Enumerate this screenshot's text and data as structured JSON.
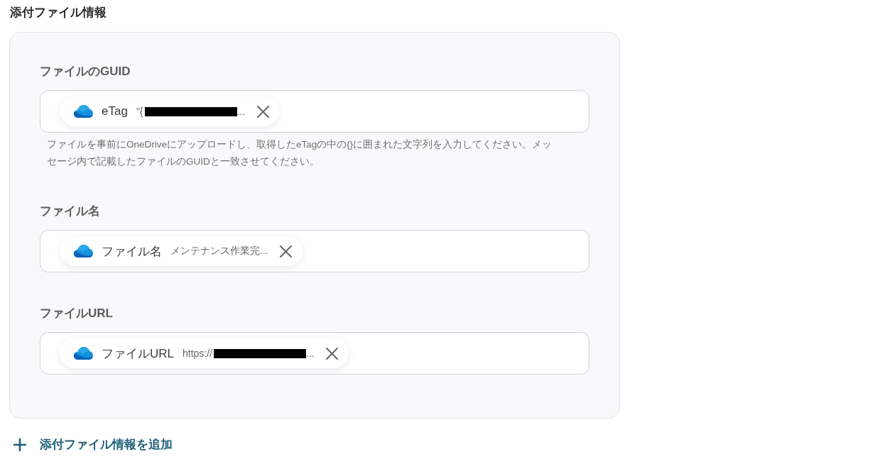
{
  "section": {
    "title": "添付ファイル情報"
  },
  "fields": [
    {
      "label": "ファイルのGUID",
      "chip": {
        "name": "eTag",
        "value": "\"{",
        "redacted": true,
        "value_end": "..."
      },
      "help": "ファイルを事前にOneDriveにアップロードし、取得したeTagの中の{}に囲まれた文字列を入力してください。メッセージ内で記載したファイルのGUIDと一致させてください。"
    },
    {
      "label": "ファイル名",
      "chip": {
        "name": "ファイル名",
        "value": "メンテナンス作業完...",
        "redacted": false
      }
    },
    {
      "label": "ファイルURL",
      "chip": {
        "name": "ファイルURL",
        "value": "https://",
        "redacted": true,
        "value_end": "..."
      }
    }
  ],
  "add_button": {
    "label": "添付ファイル情報を追加"
  }
}
